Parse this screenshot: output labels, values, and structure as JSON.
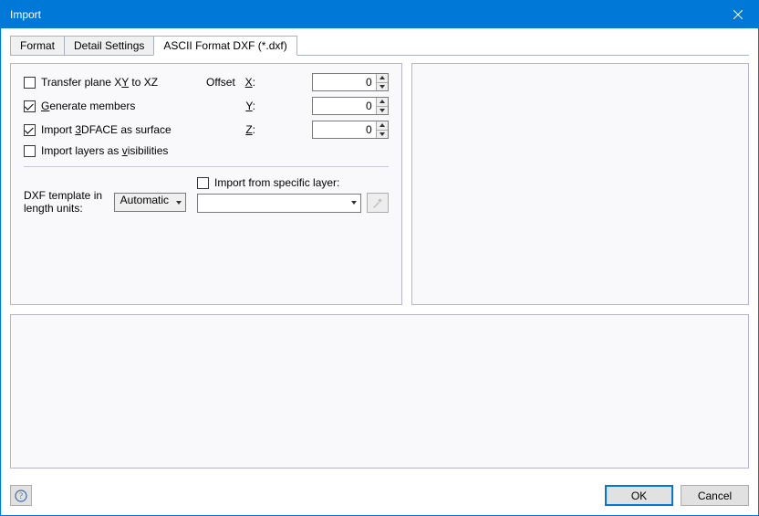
{
  "window": {
    "title": "Import"
  },
  "tabs": {
    "items": [
      {
        "label": "Format"
      },
      {
        "label": "Detail Settings"
      },
      {
        "label": "ASCII Format DXF (*.dxf)"
      }
    ],
    "activeIndex": 2
  },
  "options": {
    "transfer_plane": {
      "label_pre": "Transfer plane X",
      "label_mid": "Y to XZ",
      "checked": false
    },
    "generate_members": {
      "label_pre": "",
      "label_hot": "G",
      "label_post": "enerate members",
      "checked": true
    },
    "import_3dface": {
      "label": "Import ",
      "label_hot": "3",
      "label_post": "DFACE as surface",
      "checked": true
    },
    "import_layers_vis": {
      "label": "Import layers as ",
      "label_hot": "v",
      "label_post": "isibilities",
      "checked": false
    }
  },
  "offset": {
    "label": "Offset",
    "x": {
      "label": "X",
      "label_hot": "X",
      "value": "0"
    },
    "y": {
      "label": "Y",
      "label_hot": "Y",
      "value": "0"
    },
    "z": {
      "label": "Z",
      "label_hot": "Z",
      "value": "0"
    }
  },
  "template": {
    "label": "DXF template in length units:",
    "value": "Automatic",
    "options": [
      "Automatic"
    ]
  },
  "layer": {
    "checkbox_label": "Import from specific layer:",
    "checked": false,
    "value": "",
    "options": []
  },
  "icons": {
    "pick": "pick-icon",
    "help": "help-icon"
  },
  "footer": {
    "ok": "OK",
    "cancel": "Cancel"
  }
}
